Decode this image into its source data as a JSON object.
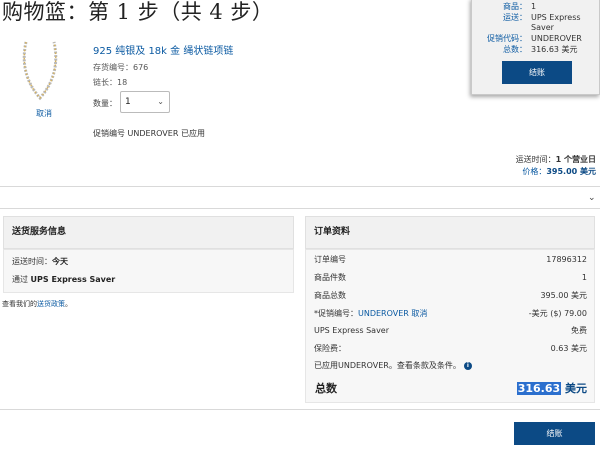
{
  "page": {
    "title": "购物篮：第 1 步（共 4 步）"
  },
  "floating_summary": {
    "rows": [
      {
        "label": "商品：",
        "value": "1"
      },
      {
        "label": "运送：",
        "value": "UPS Express"
      },
      {
        "label": "",
        "value": "Saver"
      },
      {
        "label": "促销代码：",
        "value": "UNDEROVER"
      },
      {
        "label": "总数：",
        "value": "316.63 美元"
      }
    ],
    "checkout_label": "结账"
  },
  "item": {
    "name": "925 纯银及 18k 金 绳状链项链",
    "stock_label": "存货编号：676",
    "length_label": "链长：18",
    "qty_label": "数量：",
    "qty_value": "1",
    "cancel_label": "取消",
    "promo_applied": "促销编号 UNDEROVER 已应用",
    "ship_time_label": "运送时间：",
    "ship_time_value": "1 个营业日",
    "price_label": "价格：",
    "price_value": "395.00 美元"
  },
  "delivery": {
    "heading": "送货服务信息",
    "time_label": "运送时间：",
    "time_value": "今天",
    "via_label": "通过 ",
    "via_value": "UPS Express Saver",
    "policy_prefix": "查看我们的",
    "policy_link": "送货政策",
    "policy_suffix": "。"
  },
  "order": {
    "heading": "订单资料",
    "rows": [
      {
        "label": "订单编号",
        "value": "17896312"
      },
      {
        "label": "商品件数",
        "value": "1"
      },
      {
        "label": "商品总数",
        "value": "395.00 美元"
      },
      {
        "label": "*促销编号：",
        "promo_code": "UNDEROVER",
        "remove": "取消",
        "value": "-美元 ($) 79.00"
      },
      {
        "label": "UPS Express Saver",
        "value": "免费"
      },
      {
        "label": "保险费：",
        "value": "0.63 美元"
      },
      {
        "label": "已应用UNDEROVER。查看条款及条件。",
        "value": ""
      }
    ],
    "total_label": "总数",
    "total_amount": "316.63",
    "total_currency": " 美元"
  },
  "checkout_label": "结账",
  "colors": {
    "accent": "#0c4a85",
    "link": "#0b5aa2",
    "highlight": "#2b6fce"
  },
  "icons": {
    "info": "info-icon",
    "chevron": "chevron-down-icon"
  }
}
